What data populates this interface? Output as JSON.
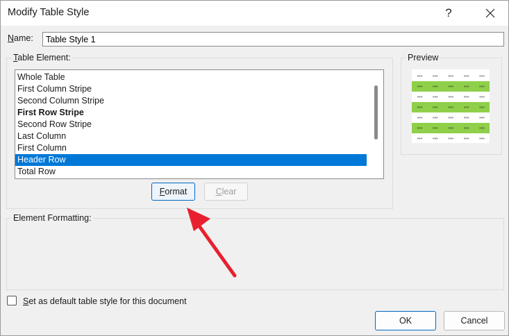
{
  "window": {
    "title": "Modify Table Style",
    "help_label": "?"
  },
  "name_field": {
    "label": "Name:",
    "value": "Table Style 1"
  },
  "table_element": {
    "label": "Table Element:",
    "items": [
      {
        "label": "Whole Table",
        "bold": false,
        "selected": false
      },
      {
        "label": "First Column Stripe",
        "bold": false,
        "selected": false
      },
      {
        "label": "Second Column Stripe",
        "bold": false,
        "selected": false
      },
      {
        "label": "First Row Stripe",
        "bold": true,
        "selected": false
      },
      {
        "label": "Second Row Stripe",
        "bold": false,
        "selected": false
      },
      {
        "label": "Last Column",
        "bold": false,
        "selected": false
      },
      {
        "label": "First Column",
        "bold": false,
        "selected": false
      },
      {
        "label": "Header Row",
        "bold": false,
        "selected": true
      },
      {
        "label": "Total Row",
        "bold": false,
        "selected": false
      }
    ],
    "format_button": "Format",
    "clear_button": "Clear"
  },
  "preview": {
    "label": "Preview",
    "cell_glyph": "»»»",
    "stripe_color": "#8fcf4a",
    "rows": 7,
    "cols": 5
  },
  "element_formatting": {
    "label": "Element Formatting:"
  },
  "default_checkbox": {
    "label": "Set as default table style for this document",
    "checked": false
  },
  "footer": {
    "ok": "OK",
    "cancel": "Cancel"
  },
  "colors": {
    "selection": "#0078d7",
    "accent_border": "#0067c0",
    "annotation_arrow": "#e8202e"
  }
}
